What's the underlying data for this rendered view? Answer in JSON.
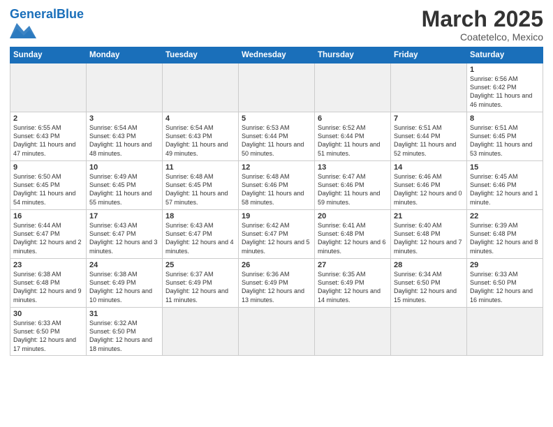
{
  "header": {
    "logo_general": "General",
    "logo_blue": "Blue",
    "month_title": "March 2025",
    "location": "Coatetelco, Mexico"
  },
  "weekdays": [
    "Sunday",
    "Monday",
    "Tuesday",
    "Wednesday",
    "Thursday",
    "Friday",
    "Saturday"
  ],
  "weeks": [
    [
      {
        "day": "",
        "info": ""
      },
      {
        "day": "",
        "info": ""
      },
      {
        "day": "",
        "info": ""
      },
      {
        "day": "",
        "info": ""
      },
      {
        "day": "",
        "info": ""
      },
      {
        "day": "",
        "info": ""
      },
      {
        "day": "1",
        "info": "Sunrise: 6:56 AM\nSunset: 6:42 PM\nDaylight: 11 hours\nand 46 minutes."
      }
    ],
    [
      {
        "day": "2",
        "info": "Sunrise: 6:55 AM\nSunset: 6:43 PM\nDaylight: 11 hours\nand 47 minutes."
      },
      {
        "day": "3",
        "info": "Sunrise: 6:54 AM\nSunset: 6:43 PM\nDaylight: 11 hours\nand 48 minutes."
      },
      {
        "day": "4",
        "info": "Sunrise: 6:54 AM\nSunset: 6:43 PM\nDaylight: 11 hours\nand 49 minutes."
      },
      {
        "day": "5",
        "info": "Sunrise: 6:53 AM\nSunset: 6:44 PM\nDaylight: 11 hours\nand 50 minutes."
      },
      {
        "day": "6",
        "info": "Sunrise: 6:52 AM\nSunset: 6:44 PM\nDaylight: 11 hours\nand 51 minutes."
      },
      {
        "day": "7",
        "info": "Sunrise: 6:51 AM\nSunset: 6:44 PM\nDaylight: 11 hours\nand 52 minutes."
      },
      {
        "day": "8",
        "info": "Sunrise: 6:51 AM\nSunset: 6:45 PM\nDaylight: 11 hours\nand 53 minutes."
      }
    ],
    [
      {
        "day": "9",
        "info": "Sunrise: 6:50 AM\nSunset: 6:45 PM\nDaylight: 11 hours\nand 54 minutes."
      },
      {
        "day": "10",
        "info": "Sunrise: 6:49 AM\nSunset: 6:45 PM\nDaylight: 11 hours\nand 55 minutes."
      },
      {
        "day": "11",
        "info": "Sunrise: 6:48 AM\nSunset: 6:45 PM\nDaylight: 11 hours\nand 57 minutes."
      },
      {
        "day": "12",
        "info": "Sunrise: 6:48 AM\nSunset: 6:46 PM\nDaylight: 11 hours\nand 58 minutes."
      },
      {
        "day": "13",
        "info": "Sunrise: 6:47 AM\nSunset: 6:46 PM\nDaylight: 11 hours\nand 59 minutes."
      },
      {
        "day": "14",
        "info": "Sunrise: 6:46 AM\nSunset: 6:46 PM\nDaylight: 12 hours\nand 0 minutes."
      },
      {
        "day": "15",
        "info": "Sunrise: 6:45 AM\nSunset: 6:46 PM\nDaylight: 12 hours\nand 1 minute."
      }
    ],
    [
      {
        "day": "16",
        "info": "Sunrise: 6:44 AM\nSunset: 6:47 PM\nDaylight: 12 hours\nand 2 minutes."
      },
      {
        "day": "17",
        "info": "Sunrise: 6:43 AM\nSunset: 6:47 PM\nDaylight: 12 hours\nand 3 minutes."
      },
      {
        "day": "18",
        "info": "Sunrise: 6:43 AM\nSunset: 6:47 PM\nDaylight: 12 hours\nand 4 minutes."
      },
      {
        "day": "19",
        "info": "Sunrise: 6:42 AM\nSunset: 6:47 PM\nDaylight: 12 hours\nand 5 minutes."
      },
      {
        "day": "20",
        "info": "Sunrise: 6:41 AM\nSunset: 6:48 PM\nDaylight: 12 hours\nand 6 minutes."
      },
      {
        "day": "21",
        "info": "Sunrise: 6:40 AM\nSunset: 6:48 PM\nDaylight: 12 hours\nand 7 minutes."
      },
      {
        "day": "22",
        "info": "Sunrise: 6:39 AM\nSunset: 6:48 PM\nDaylight: 12 hours\nand 8 minutes."
      }
    ],
    [
      {
        "day": "23",
        "info": "Sunrise: 6:38 AM\nSunset: 6:48 PM\nDaylight: 12 hours\nand 9 minutes."
      },
      {
        "day": "24",
        "info": "Sunrise: 6:38 AM\nSunset: 6:49 PM\nDaylight: 12 hours\nand 10 minutes."
      },
      {
        "day": "25",
        "info": "Sunrise: 6:37 AM\nSunset: 6:49 PM\nDaylight: 12 hours\nand 11 minutes."
      },
      {
        "day": "26",
        "info": "Sunrise: 6:36 AM\nSunset: 6:49 PM\nDaylight: 12 hours\nand 13 minutes."
      },
      {
        "day": "27",
        "info": "Sunrise: 6:35 AM\nSunset: 6:49 PM\nDaylight: 12 hours\nand 14 minutes."
      },
      {
        "day": "28",
        "info": "Sunrise: 6:34 AM\nSunset: 6:50 PM\nDaylight: 12 hours\nand 15 minutes."
      },
      {
        "day": "29",
        "info": "Sunrise: 6:33 AM\nSunset: 6:50 PM\nDaylight: 12 hours\nand 16 minutes."
      }
    ],
    [
      {
        "day": "30",
        "info": "Sunrise: 6:33 AM\nSunset: 6:50 PM\nDaylight: 12 hours\nand 17 minutes."
      },
      {
        "day": "31",
        "info": "Sunrise: 6:32 AM\nSunset: 6:50 PM\nDaylight: 12 hours\nand 18 minutes."
      },
      {
        "day": "",
        "info": ""
      },
      {
        "day": "",
        "info": ""
      },
      {
        "day": "",
        "info": ""
      },
      {
        "day": "",
        "info": ""
      },
      {
        "day": "",
        "info": ""
      }
    ]
  ]
}
